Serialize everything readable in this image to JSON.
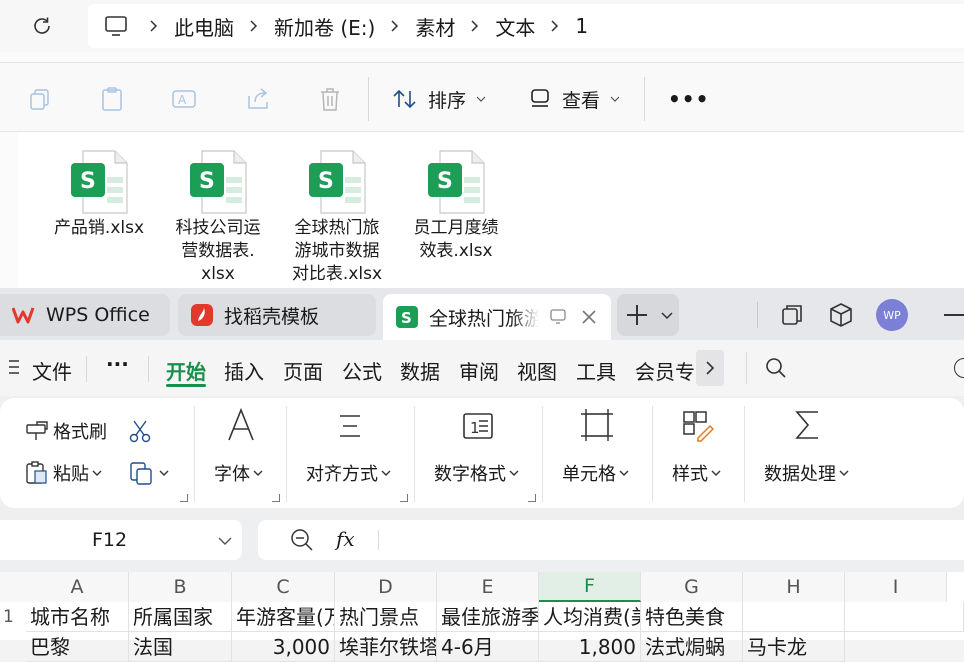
{
  "explorer": {
    "breadcrumb": [
      "此电脑",
      "新加卷 (E:)",
      "素材",
      "文本",
      "1"
    ],
    "toolbar": {
      "sort_label": "排序",
      "view_label": "查看",
      "more_label": "•••"
    },
    "files": [
      {
        "name": "产品销.xlsx",
        "icon": "xlsx-file-icon"
      },
      {
        "name": "科技公司运营数据表.xlsx",
        "icon": "xlsx-file-icon"
      },
      {
        "name": "全球热门旅游城市数据对比表.xlsx",
        "icon": "xlsx-file-icon"
      },
      {
        "name": "员工月度绩效表.xlsx",
        "icon": "xlsx-file-icon"
      }
    ],
    "file_lines": [
      [
        "产品销.xlsx"
      ],
      [
        "科技公司运",
        "营数据表.",
        "xlsx"
      ],
      [
        "全球热门旅",
        "游城市数据",
        "对比表.xlsx"
      ],
      [
        "员工月度绩",
        "效表.xlsx"
      ]
    ]
  },
  "wps": {
    "tabs": [
      {
        "label": "WPS Office",
        "icon": "wps-logo-icon"
      },
      {
        "label": "找稻壳模板",
        "icon": "docer-icon"
      },
      {
        "label": "全球热门旅游",
        "icon": "sheet-s-icon"
      }
    ],
    "avatar": "WP",
    "menu": {
      "file": "文件",
      "more": "···",
      "items": [
        "开始",
        "插入",
        "页面",
        "公式",
        "数据",
        "审阅",
        "视图",
        "工具",
        "会员专"
      ],
      "active": "开始"
    },
    "ribbon": {
      "format_painter": "格式刷",
      "paste": "粘贴",
      "font": "字体",
      "align": "对齐方式",
      "number_format": "数字格式",
      "cell": "单元格",
      "style": "样式",
      "data_process": "数据处理"
    },
    "namebox": "F12",
    "fx": "fx",
    "columns": [
      "A",
      "B",
      "C",
      "D",
      "E",
      "F",
      "G",
      "H",
      "I"
    ],
    "selected_column": "F",
    "rows": [
      {
        "num": "1",
        "cells": [
          "城市名称",
          "所属国家",
          "年游客量(万",
          "热门景点",
          "最佳旅游季",
          "人均消费(美",
          "特色美食",
          "",
          ""
        ]
      },
      {
        "num": "",
        "cells": [
          "巴黎",
          "法国",
          "3,000",
          "埃菲尔铁塔",
          "4-6月",
          "1,800",
          "法式焗蜗",
          "马卡龙",
          ""
        ]
      }
    ]
  },
  "colors": {
    "accent_green": "#1d9e57",
    "wps_red": "#e3382c",
    "active_tab": "#1a8f4c"
  }
}
